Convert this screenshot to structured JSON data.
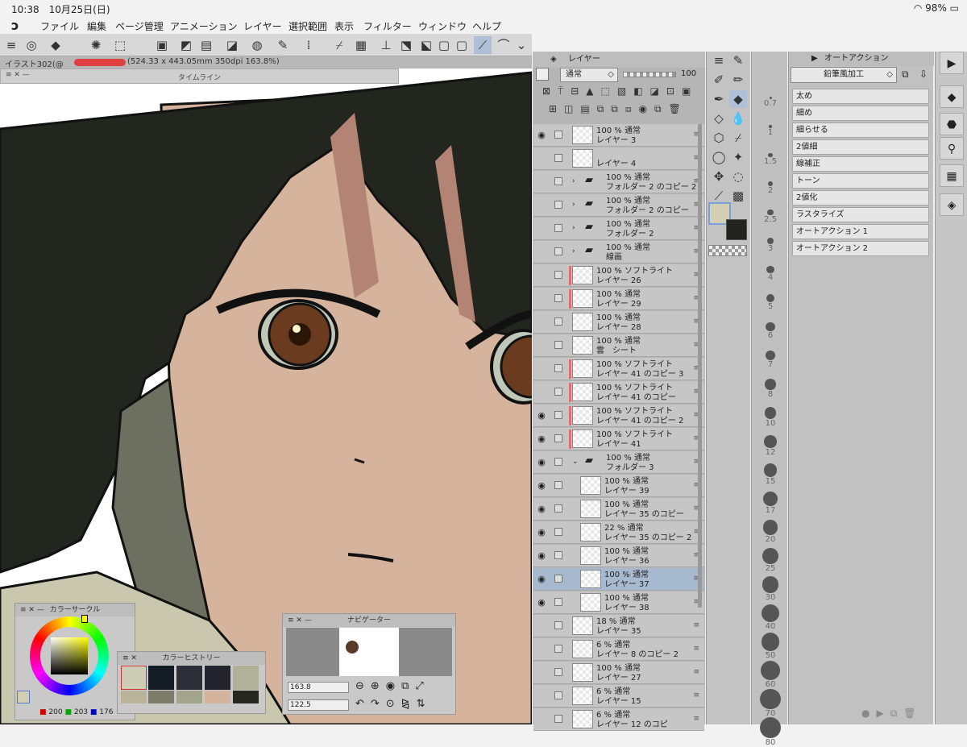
{
  "status": {
    "time": "10:38",
    "date": "10月25日(日)",
    "battery": "98%"
  },
  "menu": [
    "ファイル",
    "編集",
    "ページ管理",
    "アニメーション",
    "レイヤー",
    "選択範囲",
    "表示",
    "フィルター",
    "ウィンドウ",
    "ヘルプ"
  ],
  "document": {
    "tab": "イラスト302(@",
    "info": "(524.33 x 443.05mm 350dpi 163.8%)"
  },
  "timeline": {
    "title": "タイムライン"
  },
  "layer_panel": {
    "title": "レイヤー",
    "blend": "通常",
    "opacity": "100",
    "rows": [
      {
        "l1": "100 % 通常",
        "l2": "レイヤー 3",
        "eye": true
      },
      {
        "l1": "",
        "l2": "レイヤー 4",
        "eye": false
      },
      {
        "l1": "100 % 通常",
        "l2": "フォルダー 2 のコピー 2",
        "eye": false,
        "folder": true
      },
      {
        "l1": "100 % 通常",
        "l2": "フォルダー 2 のコピー",
        "eye": false,
        "folder": true
      },
      {
        "l1": "100 % 通常",
        "l2": "フォルダー 2",
        "eye": false,
        "folder": true
      },
      {
        "l1": "100 % 通常",
        "l2": "線画",
        "eye": false,
        "folder": true
      },
      {
        "l1": "100 % ソフトライト",
        "l2": "レイヤー 26",
        "eye": false,
        "red": true
      },
      {
        "l1": "100 % 通常",
        "l2": "レイヤー 29",
        "eye": false,
        "red": true
      },
      {
        "l1": "100 % 通常",
        "l2": "レイヤー 28",
        "eye": false
      },
      {
        "l1": "100 % 通常",
        "l2": "雲　シート",
        "eye": false
      },
      {
        "l1": "100 % ソフトライト",
        "l2": "レイヤー 41 のコピー 3",
        "eye": false,
        "red": true
      },
      {
        "l1": "100 % ソフトライト",
        "l2": "レイヤー 41 のコピー",
        "eye": false,
        "red": true
      },
      {
        "l1": "100 % ソフトライト",
        "l2": "レイヤー 41 のコピー 2",
        "eye": true,
        "red": true
      },
      {
        "l1": "100 % ソフトライト",
        "l2": "レイヤー 41",
        "eye": true,
        "red": true
      },
      {
        "l1": "100 % 通常",
        "l2": "フォルダー 3",
        "eye": true,
        "folder": true,
        "open": true
      },
      {
        "l1": "100 % 通常",
        "l2": "レイヤー 39",
        "eye": true,
        "indent": true
      },
      {
        "l1": "100 % 通常",
        "l2": "レイヤー 35 のコピー",
        "eye": true,
        "indent": true
      },
      {
        "l1": "22 % 通常",
        "l2": "レイヤー 35 のコピー 2",
        "eye": true,
        "indent": true
      },
      {
        "l1": "100 % 通常",
        "l2": "レイヤー 36",
        "eye": true,
        "indent": true
      },
      {
        "l1": "100 % 通常",
        "l2": "レイヤー 37",
        "eye": true,
        "indent": true,
        "selected": true
      },
      {
        "l1": "100 % 通常",
        "l2": "レイヤー 38",
        "eye": true,
        "indent": true
      },
      {
        "l1": "18 % 通常",
        "l2": "レイヤー 35",
        "eye": false
      },
      {
        "l1": "6 % 通常",
        "l2": "レイヤー 8 のコピー 2",
        "eye": false
      },
      {
        "l1": "100 % 通常",
        "l2": "レイヤー 27",
        "eye": false
      },
      {
        "l1": "6 % 通常",
        "l2": "レイヤー 15",
        "eye": false
      },
      {
        "l1": "6 % 通常",
        "l2": "レイヤー 12 のコピ",
        "eye": false
      }
    ]
  },
  "brush_sizes": [
    "0.7",
    "1",
    "1.5",
    "2",
    "2.5",
    "3",
    "4",
    "5",
    "6",
    "7",
    "8",
    "10",
    "12",
    "15",
    "17",
    "20",
    "25",
    "30",
    "40",
    "50",
    "60",
    "70",
    "80"
  ],
  "auto_action": {
    "title": "オートアクション",
    "set": "鉛筆風加工",
    "items": [
      "太め",
      "細め",
      "細らせる",
      "2値細",
      "線補正",
      "トーン",
      "2値化",
      "ラスタライズ",
      "オートアクション 1",
      "オートアクション 2"
    ]
  },
  "color_circle": {
    "title": "カラーサークル",
    "r": "200",
    "g": "203",
    "b": "176"
  },
  "color_history": {
    "title": "カラーヒストリー"
  },
  "navigator": {
    "title": "ナビゲーター",
    "zoom": "163.8",
    "rotate": "122.5"
  }
}
